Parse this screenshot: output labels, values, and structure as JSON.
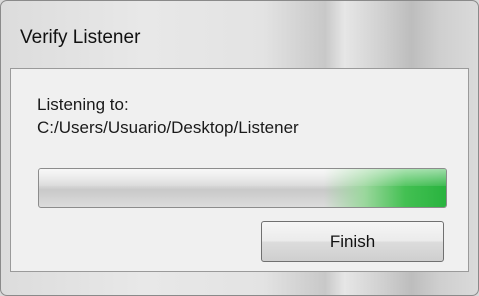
{
  "window": {
    "title": "Verify Listener"
  },
  "content": {
    "label_line1": "Listening to:",
    "path": "C:/Users/Usuario/Desktop/Listener"
  },
  "progress": {
    "fill_color": "#29b33f"
  },
  "buttons": {
    "finish_label": "Finish"
  }
}
